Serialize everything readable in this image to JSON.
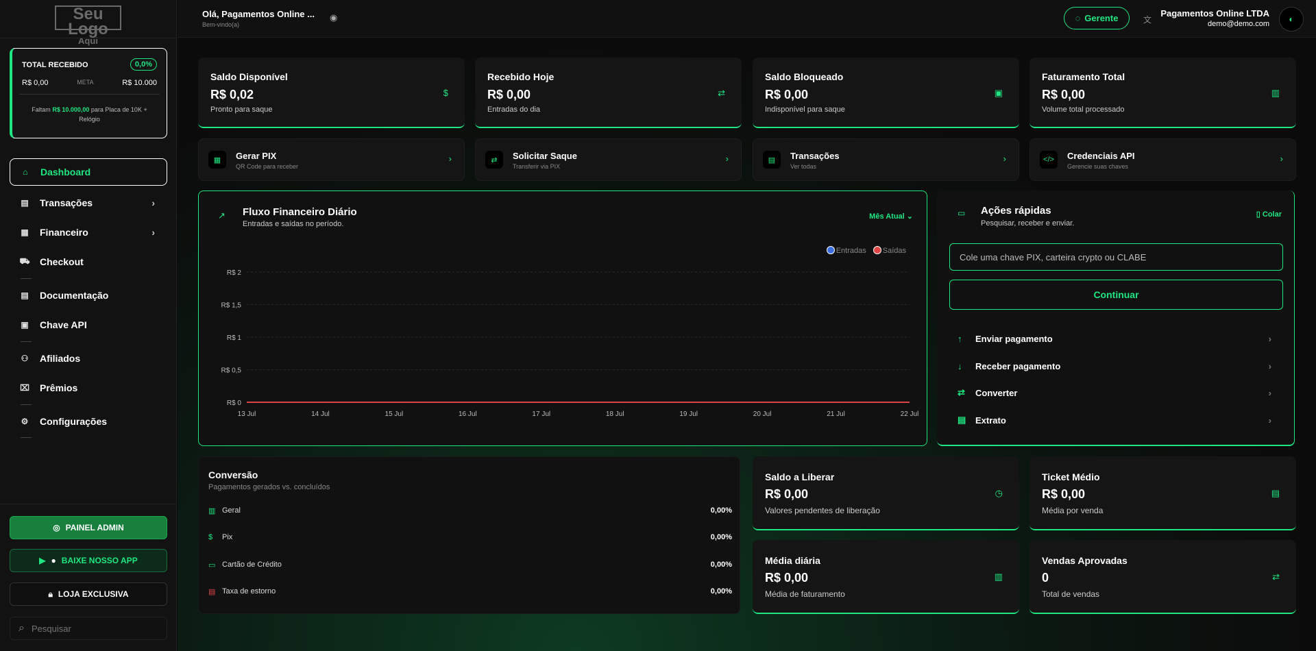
{
  "logo": {
    "line1": "Seu Logo",
    "line2": "Aqui"
  },
  "meta": {
    "title": "TOTAL RECEBIDO",
    "percent": "0,0%",
    "current": "R$ 0,00",
    "label": "META",
    "target": "R$ 10.000",
    "msg_prefix": "Faltam",
    "msg_amount": "R$ 10.000,00",
    "msg_suffix": "para Placa de 10K + Relógio"
  },
  "nav": {
    "dashboard": "Dashboard",
    "transacoes": "Transações",
    "financeiro": "Financeiro",
    "checkout": "Checkout",
    "documentacao": "Documentação",
    "chave_api": "Chave API",
    "afiliados": "Afiliados",
    "premios": "Prêmios",
    "configuracoes": "Configurações"
  },
  "sidebar_buttons": {
    "admin": "PAINEL ADMIN",
    "app": "BAIXE NOSSO APP",
    "store": "LOJA EXCLUSIVA",
    "search_placeholder": "Pesquisar"
  },
  "header": {
    "greeting": "Olá, Pagamentos Online ...",
    "welcome": "Bem-vindo(a)",
    "manager": "Gerente",
    "company": "Pagamentos Online LTDA",
    "email": "demo@demo.com"
  },
  "stats": [
    {
      "title": "Saldo Disponível",
      "value": "R$ 0,02",
      "sub": "Pronto para saque",
      "icon": "dollar-icon"
    },
    {
      "title": "Recebido Hoje",
      "value": "R$ 0,00",
      "sub": "Entradas do dia",
      "icon": "transfer-icon"
    },
    {
      "title": "Saldo Bloqueado",
      "value": "R$ 0,00",
      "sub": "Indisponível para saque",
      "icon": "lock-icon"
    },
    {
      "title": "Faturamento Total",
      "value": "R$ 0,00",
      "sub": "Volume total processado",
      "icon": "bar-chart-icon"
    }
  ],
  "quick_links": [
    {
      "title": "Gerar PIX",
      "sub": "QR Code para receber",
      "icon": "qrcode-icon"
    },
    {
      "title": "Solicitar Saque",
      "sub": "Transferir via PIX",
      "icon": "transfer-icon"
    },
    {
      "title": "Transações",
      "sub": "Ver todas",
      "icon": "document-icon"
    },
    {
      "title": "Credenciais API",
      "sub": "Gerencie suas chaves",
      "icon": "code-icon"
    }
  ],
  "chart_card": {
    "title": "Fluxo Financeiro Diário",
    "subtitle": "Entradas e saídas no período.",
    "period": "Mês Atual"
  },
  "chart_data": {
    "type": "line",
    "x": [
      "13 Jul",
      "14 Jul",
      "15 Jul",
      "16 Jul",
      "17 Jul",
      "18 Jul",
      "19 Jul",
      "20 Jul",
      "21 Jul",
      "22 Jul"
    ],
    "y_ticks": [
      "R$ 0",
      "R$ 0,5",
      "R$ 1",
      "R$ 1,5",
      "R$ 2"
    ],
    "ylim": [
      0,
      2
    ],
    "series": [
      {
        "name": "Entradas",
        "color": "#3b6fe0",
        "values": [
          0,
          0,
          0,
          0,
          0,
          0,
          0,
          0,
          0,
          0
        ]
      },
      {
        "name": "Saídas",
        "color": "#e04545",
        "values": [
          0,
          0,
          0,
          0,
          0,
          0,
          0,
          0,
          0,
          0
        ]
      }
    ],
    "grid": true,
    "legend": "top-right"
  },
  "quick_actions": {
    "title": "Ações rápidas",
    "subtitle": "Pesquisar, receber e enviar.",
    "paste": "Colar",
    "input_placeholder": "Cole uma chave PIX, carteira crypto ou CLABE",
    "continue": "Continuar",
    "items": [
      "Enviar pagamento",
      "Receber pagamento",
      "Converter",
      "Extrato"
    ]
  },
  "conversion": {
    "title": "Conversão",
    "subtitle": "Pagamentos gerados vs. concluídos",
    "rows": [
      {
        "label": "Geral",
        "value": "0,00%"
      },
      {
        "label": "Pix",
        "value": "0,00%"
      },
      {
        "label": "Cartão de Crédito",
        "value": "0,00%"
      },
      {
        "label": "Taxa de estorno",
        "value": "0,00%"
      }
    ]
  },
  "mini_stats": [
    {
      "title": "Saldo a Liberar",
      "value": "R$ 0,00",
      "sub": "Valores pendentes de liberação"
    },
    {
      "title": "Ticket Médio",
      "value": "R$ 0,00",
      "sub": "Média por venda"
    },
    {
      "title": "Média diária",
      "value": "R$ 0,00",
      "sub": "Média de faturamento"
    },
    {
      "title": "Vendas Aprovadas",
      "value": "0",
      "sub": "Total de vendas"
    }
  ],
  "colors": {
    "accent": "#1ee680",
    "danger": "#e04545",
    "entradas": "#3b6fe0"
  }
}
